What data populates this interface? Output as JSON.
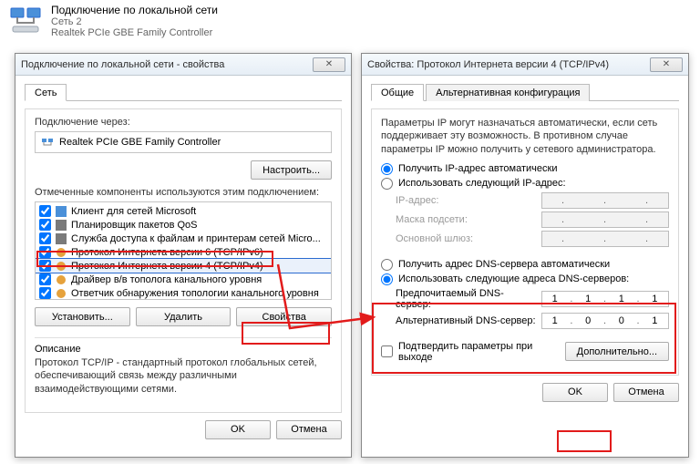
{
  "conn": {
    "title": "Подключение по локальной сети",
    "line2": "Сеть 2",
    "line3": "Realtek PCIe GBE Family Controller"
  },
  "propsWin": {
    "title": "Подключение по локальной сети - свойства",
    "tab_network": "Сеть",
    "connect_through_label": "Подключение через:",
    "adapter": "Realtek PCIe GBE Family Controller",
    "configure": "Настроить...",
    "components_label": "Отмеченные компоненты используются этим подключением:",
    "components": [
      "Клиент для сетей Microsoft",
      "Планировщик пакетов QoS",
      "Служба доступа к файлам и принтерам сетей Micro...",
      "Протокол Интернета версии 6 (TCP/IPv6)",
      "Протокол Интернета версии 4 (TCP/IPv4)",
      "Драйвер в/в тополога канального уровня",
      "Ответчик обнаружения топологии канального уровня"
    ],
    "install": "Установить...",
    "uninstall": "Удалить",
    "properties": "Свойства",
    "desc_title": "Описание",
    "desc_body": "Протокол TCP/IP - стандартный протокол глобальных сетей, обеспечивающий связь между различными взаимодействующими сетями.",
    "ok": "OK",
    "cancel": "Отмена"
  },
  "ipv4Win": {
    "title": "Свойства: Протокол Интернета версии 4 (TCP/IPv4)",
    "tab_general": "Общие",
    "tab_alt": "Альтернативная конфигурация",
    "intro": "Параметры IP могут назначаться автоматически, если сеть поддерживает эту возможность. В противном случае параметры IP можно получить у сетевого администратора.",
    "ip_auto": "Получить IP-адрес автоматически",
    "ip_manual": "Использовать следующий IP-адрес:",
    "ip_addr_label": "IP-адрес:",
    "mask_label": "Маска подсети:",
    "gw_label": "Основной шлюз:",
    "dns_auto": "Получить адрес DNS-сервера автоматически",
    "dns_manual": "Использовать следующие адреса DNS-серверов:",
    "dns_pref_label": "Предпочитаемый DNS-сервер:",
    "dns_alt_label": "Альтернативный DNS-сервер:",
    "dns_pref": [
      "1",
      "1",
      "1",
      "1"
    ],
    "dns_alt": [
      "1",
      "0",
      "0",
      "1"
    ],
    "validate": "Подтвердить параметры при выходе",
    "advanced": "Дополнительно...",
    "ok": "OK",
    "cancel": "Отмена"
  }
}
